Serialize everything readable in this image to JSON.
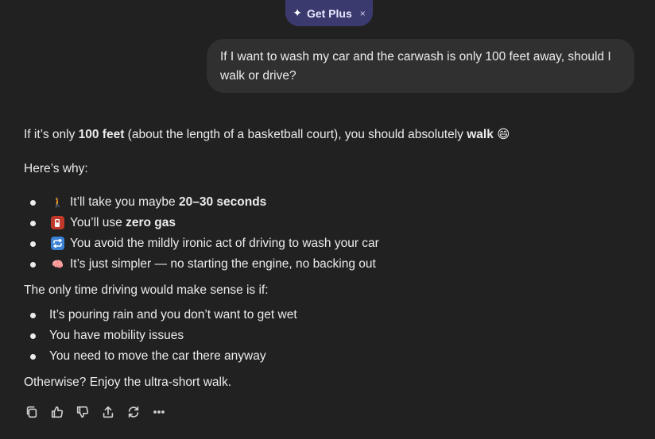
{
  "banner": {
    "label": "Get Plus",
    "spark_glyph": "✦",
    "close_glyph": "×"
  },
  "user_message": "If I want to wash my car and the carwash is only 100 feet away, should I walk or drive?",
  "answer": {
    "intro": {
      "pre": "If it’s only ",
      "b1": "100 feet",
      "mid": " (about the length of a basketball court), you should absolutely ",
      "b2": "walk",
      "emoji": "😄"
    },
    "why_label": "Here’s why:",
    "reasons": [
      {
        "emoji": "🚶",
        "icon": "person-walking-icon",
        "pre": "It’ll take you maybe ",
        "bold": "20–30 seconds",
        "post": ""
      },
      {
        "emoji": "⛽",
        "icon": "fuel-pump-icon",
        "pre": "You’ll use ",
        "bold": "zero gas",
        "post": ""
      },
      {
        "emoji": "🔁",
        "icon": "repeat-arrows-icon",
        "pre": "You avoid the mildly ironic act of driving to wash your car",
        "bold": "",
        "post": ""
      },
      {
        "emoji": "🧠",
        "icon": "brain-icon",
        "pre": "It’s just simpler — no starting the engine, no backing out",
        "bold": "",
        "post": ""
      }
    ],
    "only_time": "The only time driving would make sense is if:",
    "conditions": [
      "It’s pouring rain and you don’t want to get wet",
      "You have mobility issues",
      "You need to move the car there anyway"
    ],
    "otherwise": "Otherwise? Enjoy the ultra-short walk."
  },
  "actions": [
    "copy-icon",
    "thumbs-up-icon",
    "thumbs-down-icon",
    "share-icon",
    "regenerate-icon",
    "more-icon"
  ],
  "colors": {
    "background": "#212121",
    "bubble": "#303030",
    "banner": "#3b3a6e",
    "text": "#ececec"
  }
}
